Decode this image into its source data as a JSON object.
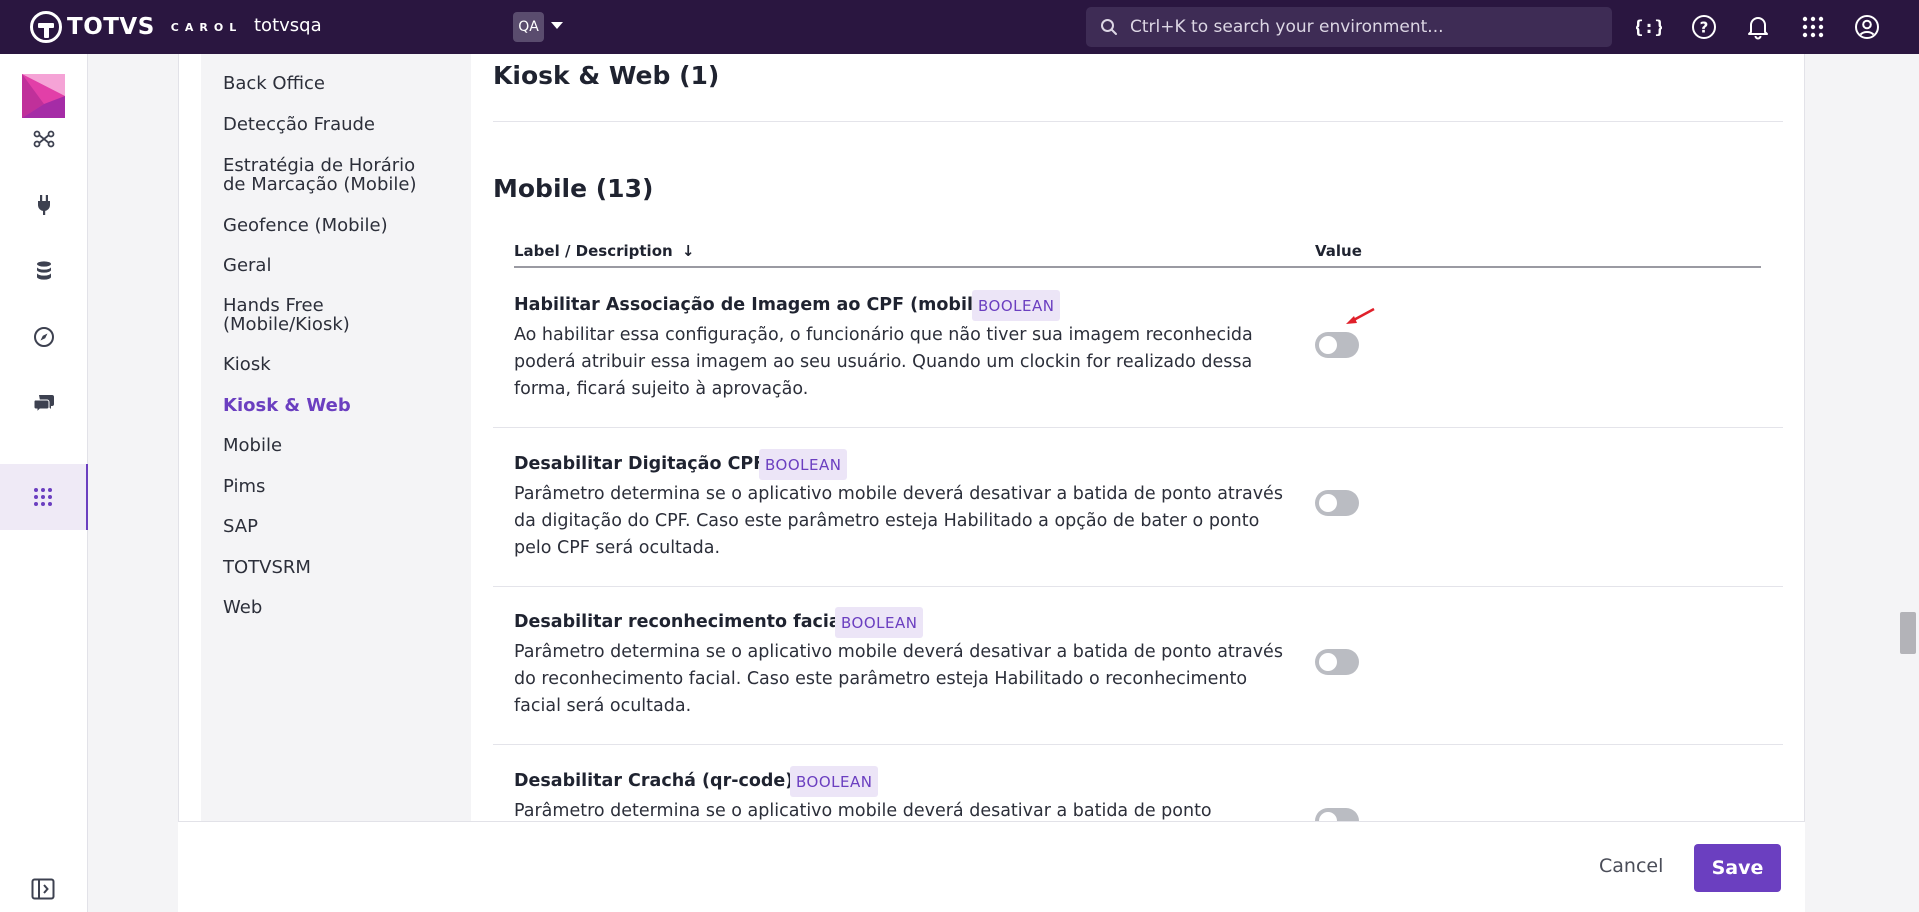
{
  "topbar": {
    "logo_text": "TOTVS",
    "logo_sub": "CAROL",
    "environment": "totvsqa",
    "env_badge": "QA",
    "search_placeholder": "Ctrl+K to search your environment..."
  },
  "subnav": {
    "items": [
      {
        "label": "Back Office"
      },
      {
        "label": "Detecção Fraude"
      },
      {
        "label": "Estratégia de Horário de Marcação (Mobile)"
      },
      {
        "label": "Geofence (Mobile)"
      },
      {
        "label": "Geral"
      },
      {
        "label": "Hands Free (Mobile/Kiosk)"
      },
      {
        "label": "Kiosk"
      },
      {
        "label": "Kiosk & Web"
      },
      {
        "label": "Mobile"
      },
      {
        "label": "Pims"
      },
      {
        "label": "SAP"
      },
      {
        "label": "TOTVSRM"
      },
      {
        "label": "Web"
      }
    ],
    "active": "Kiosk & Web"
  },
  "sections": {
    "kiosk_web_title": "Kiosk & Web (1)",
    "mobile_title": "Mobile (13)"
  },
  "table": {
    "col_label": "Label / Description",
    "sort_icon": "↓",
    "col_value": "Value"
  },
  "rows": [
    {
      "title": "Habilitar Associação de Imagem ao CPF (mobile)",
      "type": "BOOLEAN",
      "description": "Ao habilitar essa configuração, o funcionário que não tiver sua imagem reconhecida poderá atribuir essa imagem ao seu usuário. Quando um clockin for realizado dessa forma, ficará sujeito à aprovação.",
      "value": false
    },
    {
      "title": "Desabilitar Digitação CPF",
      "type": "BOOLEAN",
      "description": "Parâmetro determina se o aplicativo mobile deverá desativar a batida de ponto através da digitação do CPF. Caso este parâmetro esteja Habilitado a opção de bater o ponto pelo CPF será ocultada.",
      "value": false
    },
    {
      "title": "Desabilitar reconhecimento facial",
      "type": "BOOLEAN",
      "description": "Parâmetro determina se o aplicativo mobile deverá desativar a batida de ponto através do reconhecimento facial. Caso este parâmetro esteja Habilitado o recon­hecimento facial será ocultada.",
      "value": false
    },
    {
      "title": "Desabilitar Crachá (qr-code)",
      "type": "BOOLEAN",
      "description": "Parâmetro determina se o aplicativo mobile deverá desativar a batida de ponto",
      "value": false
    }
  ],
  "footer": {
    "cancel_label": "Cancel",
    "save_label": "Save"
  },
  "colors": {
    "topbar": "#2a1640",
    "accent": "#6b3fc0",
    "badge_bg": "#ece5f7",
    "annotation_arrow": "#e0202a"
  }
}
